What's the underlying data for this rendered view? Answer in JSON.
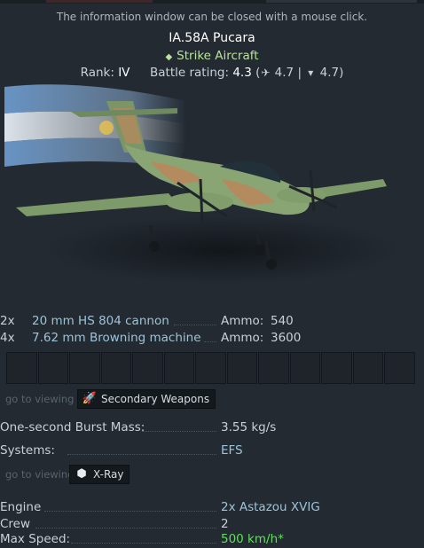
{
  "hint": "The information window can be closed with a mouse click.",
  "aircraft": {
    "name": "IA.58A Pucara",
    "class_label": "Strike Aircraft",
    "rank_label": "Rank:",
    "rank_value": "IV",
    "br_label": "Battle rating:",
    "br_value": "4.3",
    "br_realistic": "4.7",
    "br_simulator": "4.7"
  },
  "weapons": [
    {
      "count": "2x",
      "name": "20 mm HS 804 cannon",
      "ammo_label": "Ammo:",
      "ammo_value": "540"
    },
    {
      "count": "4x",
      "name": "7.62 mm Browning machine",
      "ammo_label": "Ammo:",
      "ammo_value": "3600"
    }
  ],
  "secondary_nav": {
    "goto": "go to viewing",
    "button": "Secondary Weapons",
    "icon": "secondary-weapons-icon"
  },
  "burst": {
    "label": "One-second Burst Mass:",
    "value": "3.55 kg/s"
  },
  "systems": {
    "label": "Systems:",
    "value": "EFS"
  },
  "xray_nav": {
    "goto": "go to viewing",
    "button": "X-Ray",
    "icon": "xray-icon"
  },
  "specs": {
    "engine_label": "Engine",
    "engine_value": "2x  Astazou XVIG",
    "crew_label": "Crew",
    "crew_value": "2",
    "speed_label": "Max Speed:",
    "speed_value": "500 km/h*"
  },
  "colors": {
    "background": "#232a31",
    "class_green": "#b9e29a",
    "weapon_blue": "#9ec3d9",
    "speed_green": "#5fe05a"
  }
}
